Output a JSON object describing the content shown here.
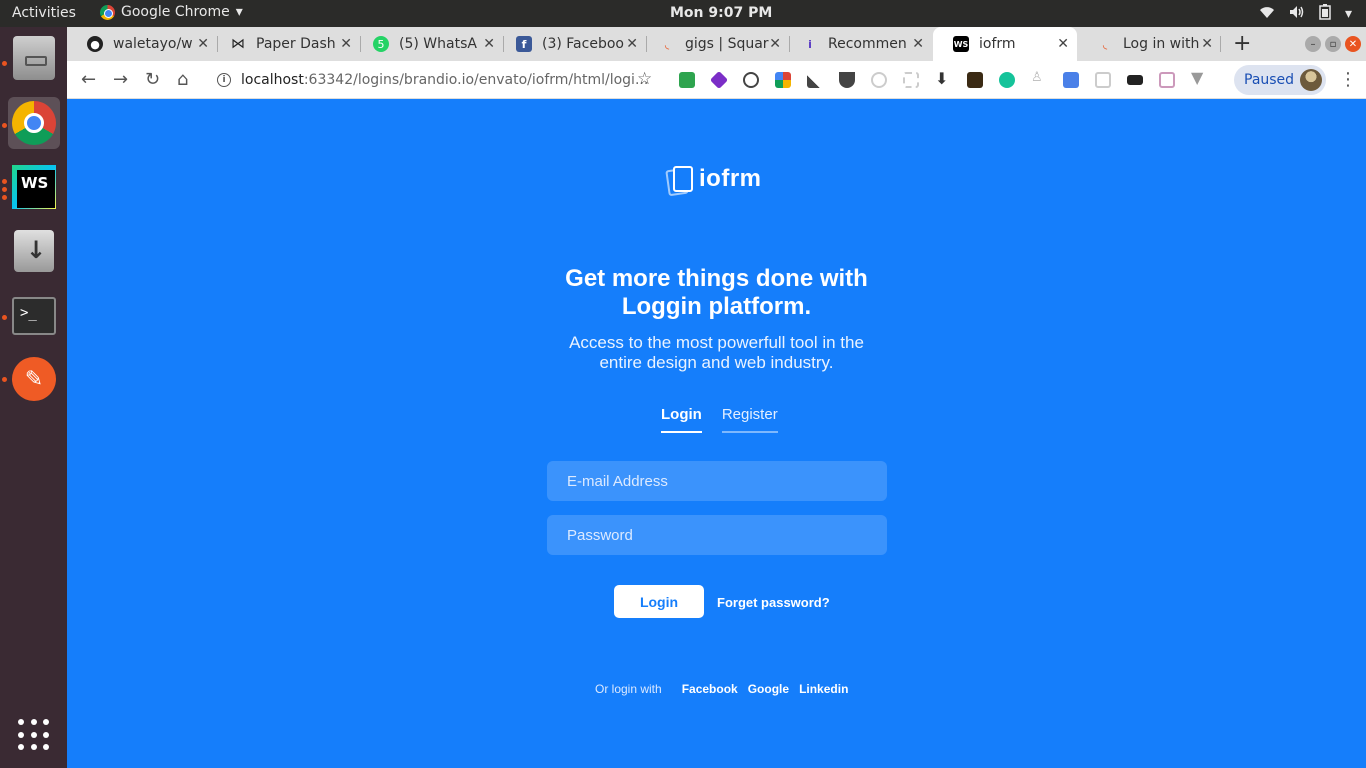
{
  "system_bar": {
    "activities": "Activities",
    "app_name": "Google Chrome",
    "clock": "Mon  9:07 PM"
  },
  "tabs": [
    {
      "title": "waletayo/w",
      "icon": "github-icon"
    },
    {
      "title": "Paper Dash",
      "icon": "bowtie-icon"
    },
    {
      "title": "(5) WhatsA",
      "icon": "whatsapp-icon"
    },
    {
      "title": "(3) Faceboo",
      "icon": "facebook-icon"
    },
    {
      "title": "gigs | Squar",
      "icon": "squarespace-icon"
    },
    {
      "title": "Recommen",
      "icon": "info-icon"
    },
    {
      "title": "iofrm",
      "icon": "webstorm-icon",
      "active": true
    },
    {
      "title": "Log in with",
      "icon": "loading-icon"
    }
  ],
  "address_bar": {
    "host": "localhost",
    "path": ":63342/logins/brandio.io/envato/iofrm/html/logi..."
  },
  "profile": {
    "label": "Paused"
  },
  "page": {
    "logo_text": "iofrm",
    "headline_line1": "Get more things done with",
    "headline_line2": "Loggin platform.",
    "subline_line1": "Access to the most powerfull tool in the",
    "subline_line2": "entire design and web industry.",
    "tab_login": "Login",
    "tab_register": "Register",
    "email_placeholder": "E-mail Address",
    "password_placeholder": "Password",
    "login_button": "Login",
    "forgot_password": "Forget password?",
    "or_login_with": "Or login with",
    "social": [
      "Facebook",
      "Google",
      "Linkedin"
    ]
  },
  "colors": {
    "page_background": "#157efb",
    "field_background": "#3b93fc",
    "dock_background": "#3a2a33",
    "ubuntu_accent": "#e95420"
  }
}
